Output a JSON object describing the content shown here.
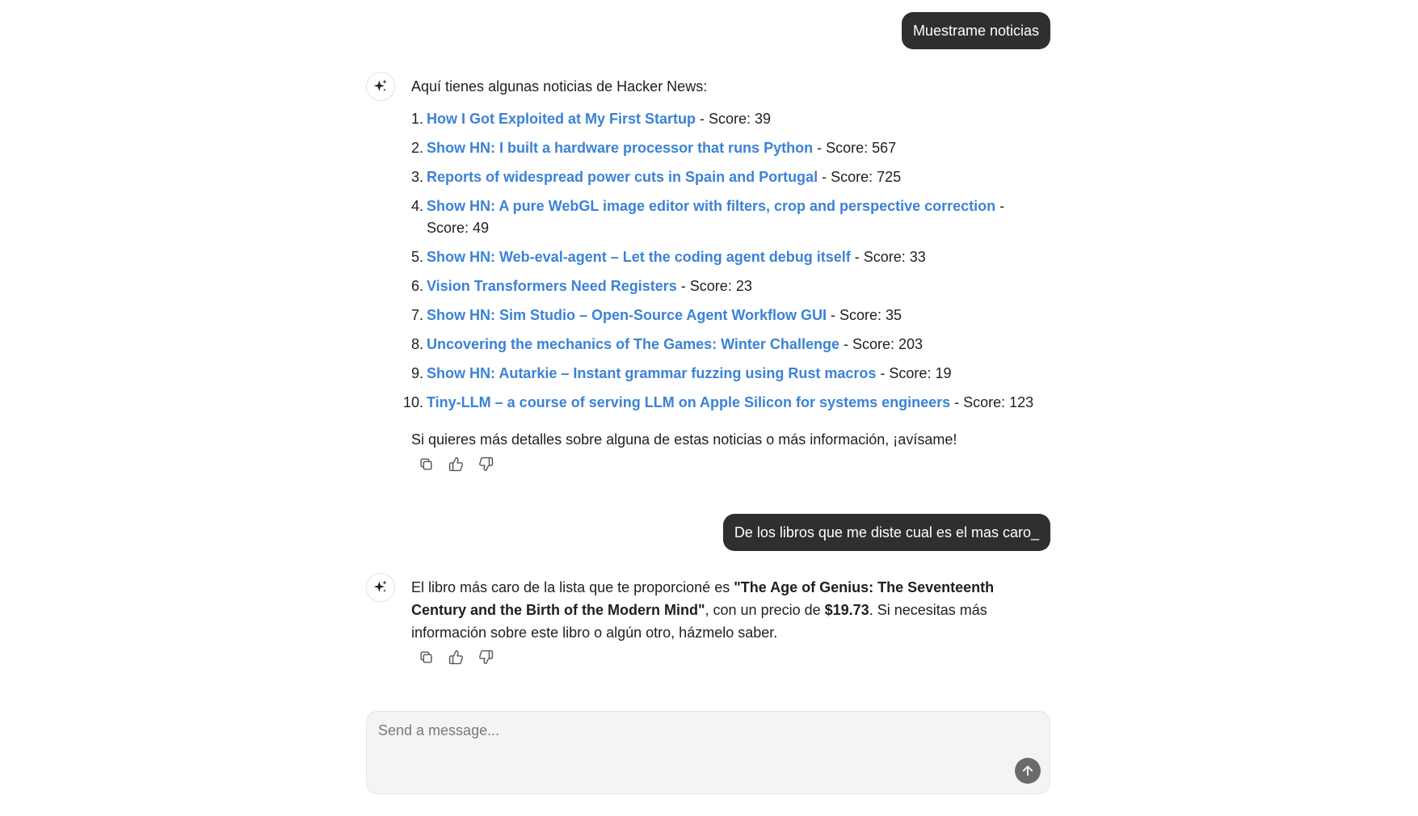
{
  "messages": {
    "user1": "Muestrame noticias",
    "assistant1": {
      "intro": "Aquí tienes algunas noticias de Hacker News:",
      "news": [
        {
          "num": "1.",
          "title": "How I Got Exploited at My First Startup",
          "score": " - Score: 39"
        },
        {
          "num": "2.",
          "title": "Show HN: I built a hardware processor that runs Python",
          "score": " - Score: 567"
        },
        {
          "num": "3.",
          "title": "Reports of widespread power cuts in Spain and Portugal",
          "score": " - Score: 725"
        },
        {
          "num": "4.",
          "title": "Show HN: A pure WebGL image editor with filters, crop and perspective correction",
          "score": " - Score: 49"
        },
        {
          "num": "5.",
          "title": "Show HN: Web-eval-agent – Let the coding agent debug itself",
          "score": " - Score: 33"
        },
        {
          "num": "6.",
          "title": "Vision Transformers Need Registers",
          "score": " - Score: 23"
        },
        {
          "num": "7.",
          "title": "Show HN: Sim Studio – Open-Source Agent Workflow GUI",
          "score": " - Score: 35"
        },
        {
          "num": "8.",
          "title": "Uncovering the mechanics of The Games: Winter Challenge",
          "score": " - Score: 203"
        },
        {
          "num": "9.",
          "title": "Show HN: Autarkie – Instant grammar fuzzing using Rust macros",
          "score": " - Score: 19"
        },
        {
          "num": "10.",
          "title": "Tiny-LLM – a course of serving LLM on Apple Silicon for systems engineers",
          "score": " - Score: 123"
        }
      ],
      "outro": "Si quieres más detalles sobre alguna de estas noticias o más información, ¡avísame!"
    },
    "user2": "De los libros que me diste cual es el mas caro_",
    "assistant2": {
      "part1": "El libro más caro de la lista que te proporcioné es ",
      "book": "\"The Age of Genius: The Seventeenth Century and the Birth of the Modern Mind\"",
      "part2": ", con un precio de ",
      "price": "$19.73",
      "part3": ". Si necesitas más información sobre este libro o algún otro, házmelo saber."
    }
  },
  "composer": {
    "placeholder": "Send a message..."
  },
  "icons": {
    "avatar": "sparkles-icon",
    "copy": "copy-icon",
    "like": "thumbs-up-icon",
    "dislike": "thumbs-down-icon",
    "send": "arrow-up-icon"
  },
  "colors": {
    "link": "#3b82d6",
    "user_bubble": "#2f2f2f",
    "send_button": "#6b6b6b"
  }
}
